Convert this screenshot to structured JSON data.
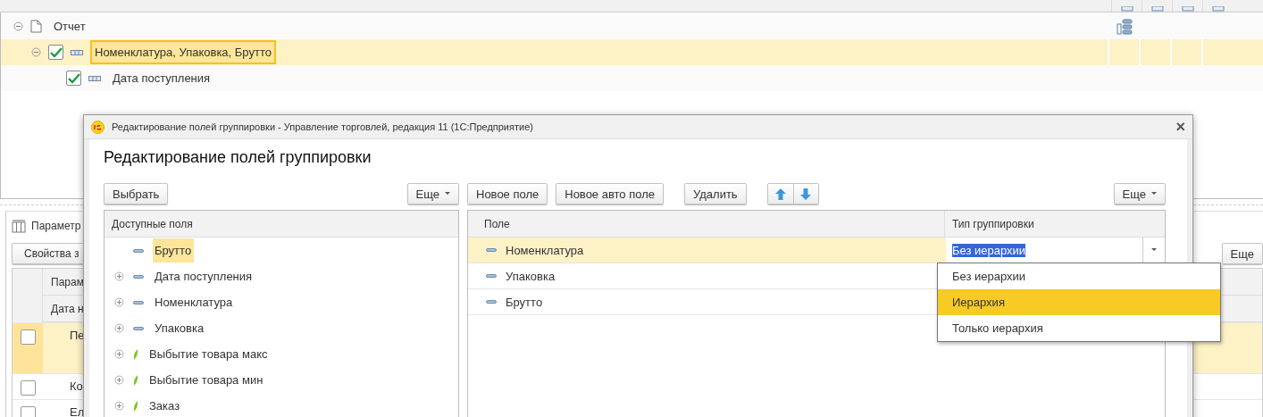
{
  "report_structure": {
    "items": [
      {
        "label": "Отчет",
        "kind": "report",
        "expanded": true,
        "selected": false,
        "children": [
          {
            "label": "Номенклатура, Упаковка, Брутто",
            "kind": "group",
            "expanded": true,
            "checked": true,
            "selected": true,
            "children": [
              {
                "label": "Дата поступления",
                "kind": "group",
                "checked": true,
                "selected": false
              }
            ]
          }
        ]
      }
    ]
  },
  "parameters_panel": {
    "title": "Параметр",
    "properties_button": "Свойства з",
    "more_button": "Еще",
    "header_rows": [
      "Парам",
      "Дата н"
    ],
    "rows": [
      {
        "text": "Пе",
        "checked": false,
        "selected": true
      },
      {
        "text": "Ко",
        "checked": false,
        "selected": false
      },
      {
        "text": "Ел",
        "checked": false,
        "selected": false
      }
    ]
  },
  "dialog": {
    "window_title": "Редактирование полей группировки - Управление торговлей, редакция 11  (1С:Предприятие)",
    "close": "×",
    "heading": "Редактирование полей группировки",
    "left": {
      "select_button": "Выбрать",
      "more_button": "Еще",
      "column": "Доступные поля",
      "items": [
        {
          "label": "Брутто",
          "kind": "field",
          "expandable": false,
          "selected": true
        },
        {
          "label": "Дата поступления",
          "kind": "field",
          "expandable": true,
          "selected": false
        },
        {
          "label": "Номенклатура",
          "kind": "field",
          "expandable": true,
          "selected": false
        },
        {
          "label": "Упаковка",
          "kind": "field",
          "expandable": true,
          "selected": false
        },
        {
          "label": "Выбытие товара макс",
          "kind": "resource",
          "expandable": true,
          "selected": false
        },
        {
          "label": "Выбытие товара мин",
          "kind": "resource",
          "expandable": true,
          "selected": false
        },
        {
          "label": "Заказ",
          "kind": "resource",
          "expandable": true,
          "selected": false
        }
      ]
    },
    "right": {
      "buttons": [
        "Новое поле",
        "Новое авто поле",
        "Удалить"
      ],
      "more_button": "Еще",
      "columns": [
        "Поле",
        "Тип группировки"
      ],
      "rows": [
        {
          "field": "Номенклатура",
          "type": "Без иерархии",
          "selected": true
        },
        {
          "field": "Упаковка",
          "selected": false
        },
        {
          "field": "Брутто",
          "selected": false
        }
      ],
      "dropdown": [
        {
          "label": "Без иерархии",
          "selected": false
        },
        {
          "label": "Иерархия",
          "selected": true
        },
        {
          "label": "Только иерархия",
          "selected": false
        }
      ]
    }
  }
}
